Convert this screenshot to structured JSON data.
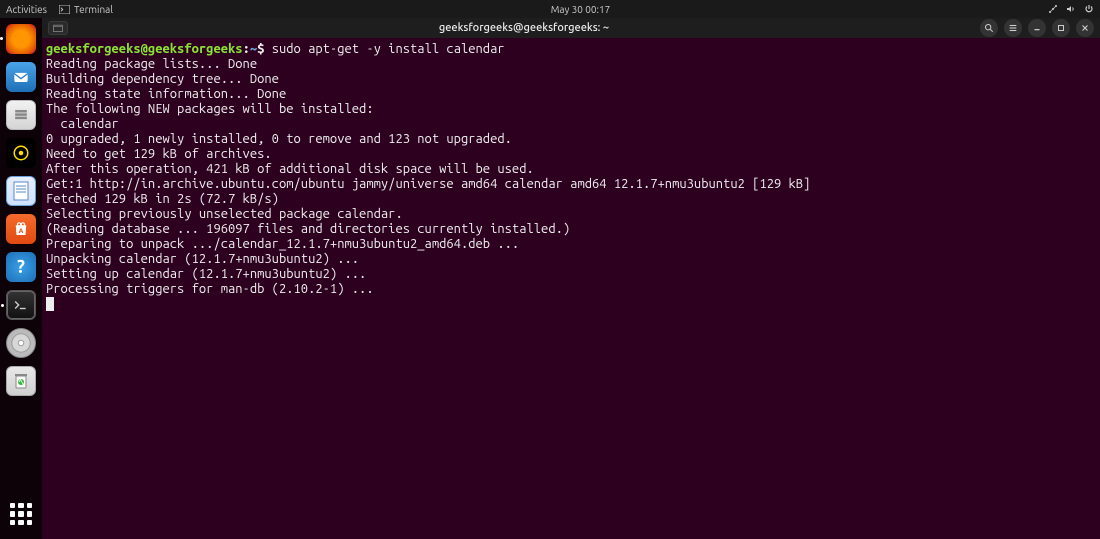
{
  "panel": {
    "activities": "Activities",
    "terminal_label": "Terminal",
    "datetime": "May 30  00:17"
  },
  "dock": {
    "firefox": "Firefox",
    "thunderbird": "Thunderbird",
    "files": "Files",
    "rhythmbox": "Rhythmbox",
    "writer": "LibreOffice Writer",
    "software": "Ubuntu Software",
    "help": "Help",
    "terminal": "Terminal",
    "disc": "Removable Disc",
    "trash": "Trash",
    "apps": "Show Applications"
  },
  "window": {
    "title": "geeksforgeeks@geeksforgeeks: ~",
    "search": "Search",
    "menu": "Menu",
    "minimize": "Minimize",
    "maximize": "Maximize",
    "close": "Close"
  },
  "prompt": {
    "user_host": "geeksforgeeks@geeksforgeeks",
    "colon": ":",
    "path": "~",
    "dollar": "$",
    "command": "sudo apt-get -y install calendar"
  },
  "output": [
    "Reading package lists... Done",
    "Building dependency tree... Done",
    "Reading state information... Done",
    "The following NEW packages will be installed:",
    "  calendar",
    "0 upgraded, 1 newly installed, 0 to remove and 123 not upgraded.",
    "Need to get 129 kB of archives.",
    "After this operation, 421 kB of additional disk space will be used.",
    "Get:1 http://in.archive.ubuntu.com/ubuntu jammy/universe amd64 calendar amd64 12.1.7+nmu3ubuntu2 [129 kB]",
    "Fetched 129 kB in 2s (72.7 kB/s)",
    "Selecting previously unselected package calendar.",
    "(Reading database ... 196097 files and directories currently installed.)",
    "Preparing to unpack .../calendar_12.1.7+nmu3ubuntu2_amd64.deb ...",
    "Unpacking calendar (12.1.7+nmu3ubuntu2) ...",
    "Setting up calendar (12.1.7+nmu3ubuntu2) ...",
    "Processing triggers for man-db (2.10.2-1) ..."
  ]
}
